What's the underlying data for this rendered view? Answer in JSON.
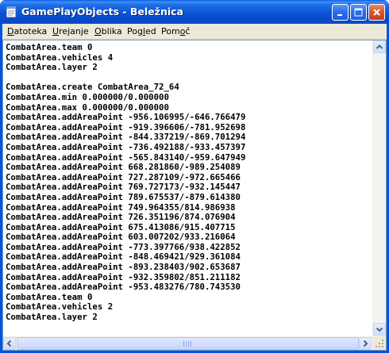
{
  "window": {
    "title": "GamePlayObjects - Beležnica",
    "buttons": {
      "minimize": "minimize",
      "maximize": "maximize",
      "close": "close"
    }
  },
  "menu": [
    {
      "underline": "D",
      "rest": "atoteka"
    },
    {
      "underline": "U",
      "rest": "rejanje"
    },
    {
      "underline": "O",
      "rest": "blika"
    },
    {
      "underline": "",
      "rest": "Pogled",
      "ul_index": 3
    },
    {
      "underline": "",
      "rest": "Pomoč",
      "ul_index": 3
    }
  ],
  "document": {
    "lines": [
      "CombatArea.team 0",
      "CombatArea.vehicles 4",
      "CombatArea.layer 2",
      "",
      "CombatArea.create CombatArea_72_64",
      "CombatArea.min 0.000000/0.000000",
      "CombatArea.max 0.000000/0.000000",
      "CombatArea.addAreaPoint -956.106995/-646.766479",
      "CombatArea.addAreaPoint -919.396606/-781.952698",
      "CombatArea.addAreaPoint -844.337219/-869.701294",
      "CombatArea.addAreaPoint -736.492188/-933.457397",
      "CombatArea.addAreaPoint -565.843140/-959.647949",
      "CombatArea.addAreaPoint 668.281860/-989.254089",
      "CombatArea.addAreaPoint 727.287109/-972.665466",
      "CombatArea.addAreaPoint 769.727173/-932.145447",
      "CombatArea.addAreaPoint 789.675537/-879.614380",
      "CombatArea.addAreaPoint 749.964355/814.986938",
      "CombatArea.addAreaPoint 726.351196/874.076904",
      "CombatArea.addAreaPoint 675.413086/915.407715",
      "CombatArea.addAreaPoint 603.007202/933.216064",
      "CombatArea.addAreaPoint -773.397766/938.422852",
      "CombatArea.addAreaPoint -848.469421/929.361084",
      "CombatArea.addAreaPoint -893.238403/902.653687",
      "CombatArea.addAreaPoint -932.359802/851.211182",
      "CombatArea.addAreaPoint -953.483276/780.743530",
      "CombatArea.team 0",
      "CombatArea.vehicles 2",
      "CombatArea.layer 2"
    ]
  },
  "icons": {
    "app": "notepad-icon",
    "scroll_up": "arrow-up-icon",
    "scroll_down": "arrow-down-icon",
    "scroll_left": "arrow-left-icon",
    "scroll_right": "arrow-right-icon"
  },
  "colors": {
    "titlebar": "#0b55d6",
    "menubar": "#ece9d8",
    "close_button": "#c43d16"
  }
}
